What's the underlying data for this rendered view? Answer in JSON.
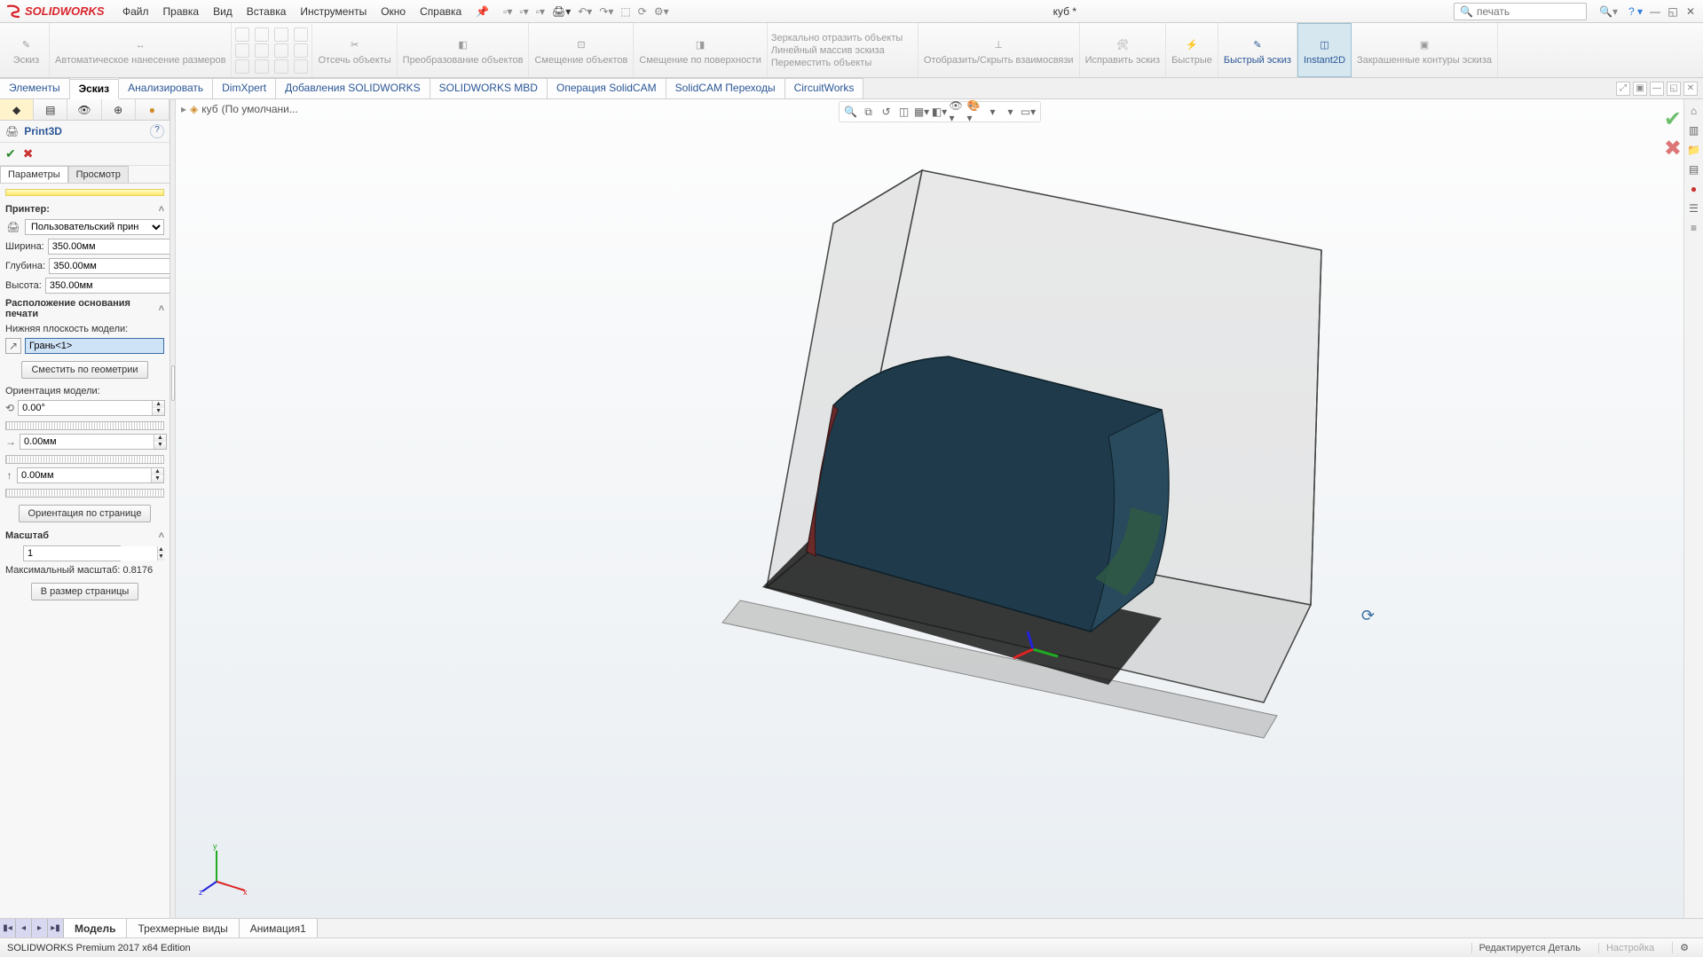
{
  "app": {
    "logo_text": "SOLIDWORKS"
  },
  "menus": {
    "file": "Файл",
    "edit": "Правка",
    "view": "Вид",
    "insert": "Вставка",
    "tools": "Инструменты",
    "window": "Окно",
    "help": "Справка"
  },
  "doc_title": "куб *",
  "search": {
    "placeholder": "печать"
  },
  "ribbon": {
    "sketch": "Эскиз",
    "smartdim": "Автоматическое нанесение размеров",
    "trim": "Отсечь объекты",
    "convert": "Преобразование объектов",
    "offset": "Смещение объектов",
    "offset_surf": "Смещение по поверхности",
    "mirror": "Зеркально отразить объекты",
    "linear": "Линейный массив эскиза",
    "move": "Переместить объекты",
    "relations": "Отобразить/Скрыть взаимосвязи",
    "repair": "Исправить эскиз",
    "quick": "Быстрые",
    "rapid": "Быстрый эскиз",
    "instant": "Instant2D",
    "shaded": "Закрашенные контуры эскиза"
  },
  "cmdtabs": {
    "elements": "Элементы",
    "sketch": "Эскиз",
    "analyze": "Анализировать",
    "dimxpert": "DimXpert",
    "addins": "Добавления SOLIDWORKS",
    "mbd": "SOLIDWORKS MBD",
    "solidcam_op": "Операция  SolidCAM",
    "solidcam_tr": "SolidCAM Переходы",
    "circuit": "CircuitWorks"
  },
  "breadcrumb": {
    "part": "куб",
    "config": "(По умолчани..."
  },
  "pm": {
    "title": "Print3D",
    "tab_params": "Параметры",
    "tab_preview": "Просмотр",
    "printer_head": "Принтер:",
    "printer_sel": "Пользовательский прин",
    "width_lbl": "Ширина:",
    "width_val": "350.00мм",
    "depth_lbl": "Глубина:",
    "depth_val": "350.00мм",
    "height_lbl": "Высота:",
    "height_val": "350.00мм",
    "loc_head": "Расположение основания печати",
    "bottom_lbl": "Нижняя плоскость модели:",
    "face_sel": "Грань<1>",
    "offset_btn": "Сместить по геометрии",
    "orient_lbl": "Ориентация модели:",
    "angle": "0.00°",
    "dx": "0.00мм",
    "dy": "0.00мм",
    "orient_btn": "Ориентация по странице",
    "scale_head": "Масштаб",
    "scale_val": "1",
    "scale_max": "Максимальный масштаб: 0.8176",
    "fit_btn": "В размер страницы"
  },
  "bottom": {
    "model": "Модель",
    "views3d": "Трехмерные виды",
    "anim": "Анимация1"
  },
  "status": {
    "edition": "SOLIDWORKS Premium 2017 x64 Edition",
    "mode": "Редактируется Деталь",
    "custom": "Настройка"
  }
}
